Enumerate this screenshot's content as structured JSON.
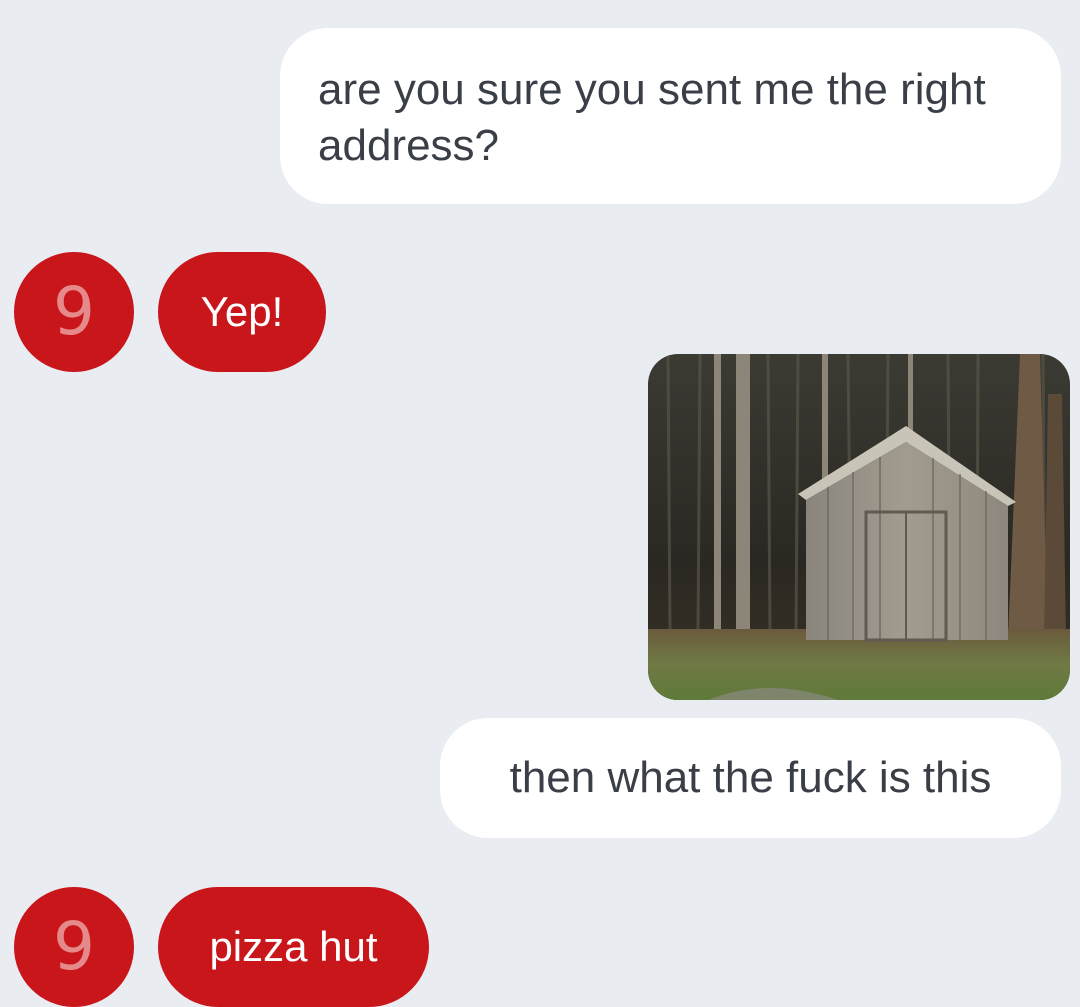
{
  "conversation": {
    "messages": [
      {
        "sender": "me",
        "text": "are you sure you sent me the right address?"
      },
      {
        "sender": "contact",
        "avatar_glyph": "9",
        "text": "Yep!"
      },
      {
        "sender": "me",
        "type": "image",
        "image_subject": "wooden shed in woods"
      },
      {
        "sender": "me",
        "text": "then what the fuck is this"
      },
      {
        "sender": "contact",
        "avatar_glyph": "9",
        "text": "pizza hut"
      }
    ]
  },
  "colors": {
    "background": "#e9ecf0",
    "outgoing_bubble": "#ffffff",
    "outgoing_text": "#3a3f47",
    "incoming_bubble": "#c8161b",
    "incoming_text": "#ffffff",
    "avatar_glyph": "#e5898a"
  }
}
